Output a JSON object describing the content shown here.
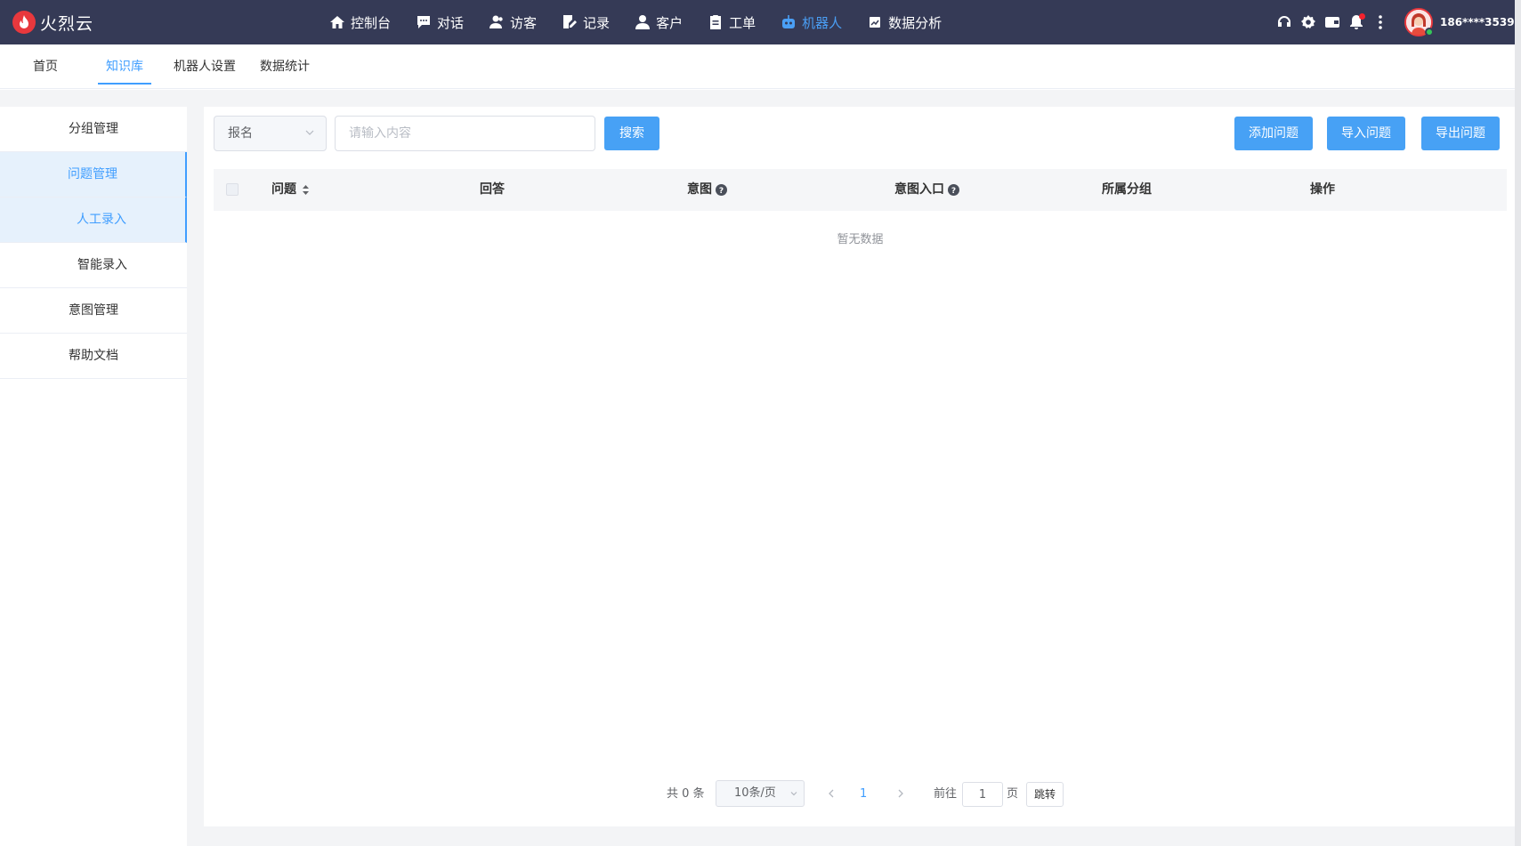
{
  "app": {
    "logo_text": "火烈云"
  },
  "nav": [
    {
      "label": "控制台",
      "icon": "home-icon"
    },
    {
      "label": "对话",
      "icon": "chat-icon"
    },
    {
      "label": "访客",
      "icon": "visitors-icon"
    },
    {
      "label": "记录",
      "icon": "record-icon"
    },
    {
      "label": "客户",
      "icon": "customer-icon"
    },
    {
      "label": "工单",
      "icon": "ticket-icon"
    },
    {
      "label": "机器人",
      "icon": "robot-icon",
      "active": true
    },
    {
      "label": "数据分析",
      "icon": "analytics-icon"
    }
  ],
  "user": {
    "name": "186****3539"
  },
  "subtabs": [
    "首页",
    "知识库",
    "机器人设置",
    "数据统计"
  ],
  "sidebar": {
    "items": [
      "分组管理",
      "问题管理",
      "人工录入",
      "智能录入",
      "意图管理",
      "帮助文档"
    ]
  },
  "toolbar": {
    "select_value": "报名",
    "search_placeholder": "请输入内容",
    "search_label": "搜索",
    "add_label": "添加问题",
    "import_label": "导入问题",
    "export_label": "导出问题"
  },
  "table": {
    "columns": [
      "问题",
      "回答",
      "意图",
      "意图入口",
      "所属分组",
      "操作"
    ],
    "empty_text": "暂无数据"
  },
  "pagination": {
    "total": "共 0 条",
    "page_size": "10条/页",
    "current_page": "1",
    "goto_prefix": "前往",
    "goto_value": "1",
    "goto_suffix": "页",
    "jump_label": "跳转"
  },
  "colors": {
    "topbar": "#353a56",
    "accent": "#409eff",
    "button": "#47a1f5",
    "logo": "#e8383d"
  }
}
